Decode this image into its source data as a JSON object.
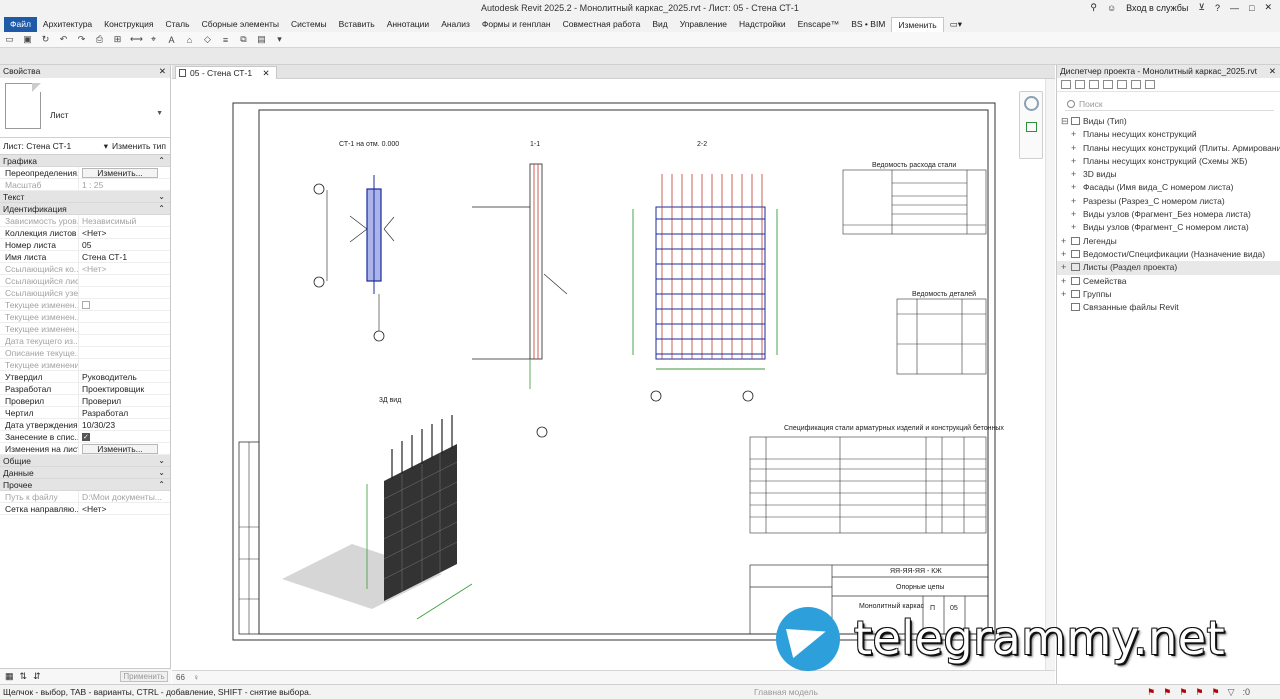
{
  "window": {
    "title": "Autodesk Revit 2025.2 - Монолитный каркас_2025.rvt - Лист: 05 - Стена СТ-1",
    "signin": "Вход в службы"
  },
  "ribbon": {
    "tabs": [
      "Файл",
      "Архитектура",
      "Конструкция",
      "Сталь",
      "Сборные элементы",
      "Системы",
      "Вставить",
      "Аннотации",
      "Анализ",
      "Формы и генплан",
      "Совместная работа",
      "Вид",
      "Управление",
      "Надстройки",
      "Enscape™",
      "BS • BIM",
      "Изменить"
    ],
    "active_tab": "Изменить"
  },
  "properties": {
    "title": "Свойства",
    "type_name": "Лист",
    "selector": "Лист: Стена СТ-1",
    "edit_type": "Изменить тип",
    "groups": [
      {
        "name": "Графика",
        "rows": [
          {
            "k": "Переопределения...",
            "v": "Изменить...",
            "btn": true
          },
          {
            "k": "Масштаб",
            "v": "1 : 25",
            "dim": true
          }
        ]
      },
      {
        "name": "Текст",
        "rows": []
      },
      {
        "name": "Идентификация",
        "rows": [
          {
            "k": "Зависимость уров...",
            "v": "Независимый",
            "dim": true
          },
          {
            "k": "Коллекция листов",
            "v": "<Нет>"
          },
          {
            "k": "Номер листа",
            "v": "05"
          },
          {
            "k": "Имя листа",
            "v": "Стена СТ-1"
          },
          {
            "k": "Ссылающийся ко...",
            "v": "<Нет>",
            "dim": true
          },
          {
            "k": "Ссылающийся лист",
            "v": "",
            "dim": true
          },
          {
            "k": "Ссылающийся узел",
            "v": "",
            "dim": true
          },
          {
            "k": "Текущее изменен...",
            "v": "",
            "dim": true,
            "check": "off"
          },
          {
            "k": "Текущее изменен...",
            "v": "",
            "dim": true
          },
          {
            "k": "Текущее изменен...",
            "v": "",
            "dim": true
          },
          {
            "k": "Дата текущего из...",
            "v": "",
            "dim": true
          },
          {
            "k": "Описание текуще...",
            "v": "",
            "dim": true
          },
          {
            "k": "Текущее изменение",
            "v": "",
            "dim": true
          },
          {
            "k": "Утвердил",
            "v": "Руководитель"
          },
          {
            "k": "Разработал",
            "v": "Проектировщик"
          },
          {
            "k": "Проверил",
            "v": "Проверил"
          },
          {
            "k": "Чертил",
            "v": "Разработал"
          },
          {
            "k": "Дата утверждения ...",
            "v": "10/30/23"
          },
          {
            "k": "Занесение в спис...",
            "v": "",
            "check": "on"
          },
          {
            "k": "Изменения на листе",
            "v": "Изменить...",
            "btn": true
          }
        ]
      },
      {
        "name": "Общие",
        "rows": []
      },
      {
        "name": "Данные",
        "rows": []
      },
      {
        "name": "Прочее",
        "rows": [
          {
            "k": "Путь к файлу",
            "v": "D:\\Мои документы...",
            "dim": true
          },
          {
            "k": "Сетка направляю...",
            "v": "<Нет>"
          }
        ]
      }
    ],
    "apply": "Применить"
  },
  "view": {
    "tab_label": "05 - Стена СТ-1",
    "scale_label": "Главная модель"
  },
  "drawing": {
    "label_plan": "СТ-1 на отм. 0.000",
    "label_11": "1-1",
    "label_22": "2-2",
    "label_3d": "3Д вид",
    "table1_title": "Ведомость расхода стали",
    "table2_title": "Ведомость деталей",
    "table3_title": "Спецификация стали арматурных изделий и конструкций бетонных",
    "stamp_code": "ЯЯ-ЯЯ-ЯЯ - КЖ",
    "stamp_name": "Монолитный каркас",
    "stamp_stage": "П",
    "stamp_sheet": "05",
    "stamp_title": "Опорные цепы"
  },
  "browser": {
    "title": "Диспетчер проекта - Монолитный каркас_2025.rvt",
    "search_placeholder": "Поиск",
    "items": [
      {
        "label": "Виды (Тип)",
        "level": 0,
        "toggle": "⊟",
        "icon": true
      },
      {
        "label": "Планы несущих конструкций",
        "level": 1,
        "toggle": "+"
      },
      {
        "label": "Планы несущих конструкций (Плиты. Армирование)",
        "level": 1,
        "toggle": "+"
      },
      {
        "label": "Планы несущих конструкций (Схемы ЖБ)",
        "level": 1,
        "toggle": "+"
      },
      {
        "label": "3D виды",
        "level": 1,
        "toggle": "+"
      },
      {
        "label": "Фасады (Имя вида_С номером листа)",
        "level": 1,
        "toggle": "+"
      },
      {
        "label": "Разрезы (Разрез_С номером листа)",
        "level": 1,
        "toggle": "+"
      },
      {
        "label": "Виды узлов (Фрагмент_Без номера листа)",
        "level": 1,
        "toggle": "+"
      },
      {
        "label": "Виды узлов (Фрагмент_С номером листа)",
        "level": 1,
        "toggle": "+"
      },
      {
        "label": "Легенды",
        "level": 0,
        "toggle": "+",
        "icon": true
      },
      {
        "label": "Ведомости/Спецификации (Назначение вида)",
        "level": 0,
        "toggle": "+",
        "icon": true
      },
      {
        "label": "Листы (Раздел проекта)",
        "level": 0,
        "toggle": "+",
        "icon": true,
        "selected": true
      },
      {
        "label": "Семейства",
        "level": 0,
        "toggle": "+",
        "icon": true
      },
      {
        "label": "Группы",
        "level": 0,
        "toggle": "+",
        "icon": true
      },
      {
        "label": "Связанные файлы Revit",
        "level": 0,
        "toggle": "",
        "icon": true
      }
    ]
  },
  "status": {
    "message": "Щелчок - выбор, TAB - варианты, CTRL - добавление, SHIFT - снятие выбора.",
    "model": "Главная модель",
    "counter": ":0"
  },
  "watermark": {
    "text": "telegrammy.net"
  },
  "colors": {
    "file_tab": "#1e5aa8",
    "telegram": "#2d9fdb"
  }
}
